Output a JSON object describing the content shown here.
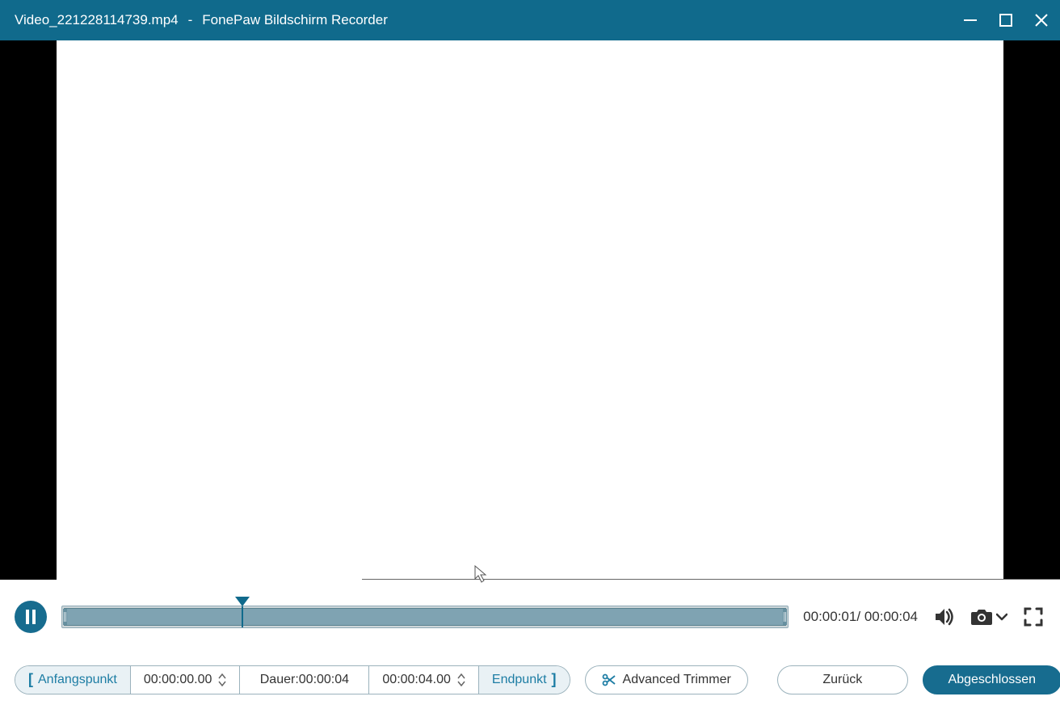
{
  "titlebar": {
    "filename": "Video_221228114739.mp4",
    "separator": "-",
    "app_name": "FonePaw Bildschirm Recorder"
  },
  "playbar": {
    "current_time": "00:00:01",
    "time_sep": "/ ",
    "total_time": "00:00:04"
  },
  "trim": {
    "start_label": "Anfangspunkt",
    "start_time": "00:00:00.00",
    "duration_label": "Dauer:",
    "duration_value": "00:00:04",
    "end_time": "00:00:04.00",
    "end_label": "Endpunkt"
  },
  "buttons": {
    "advanced_trimmer": "Advanced Trimmer",
    "back": "Zurück",
    "done": "Abgeschlossen"
  }
}
